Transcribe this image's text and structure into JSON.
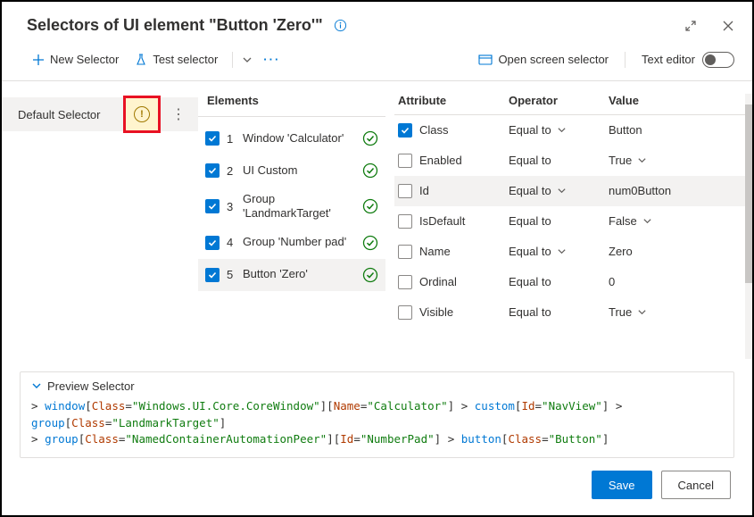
{
  "header": {
    "title": "Selectors of UI element \"Button 'Zero'\""
  },
  "toolbar": {
    "new_selector": "New Selector",
    "test_selector": "Test selector",
    "open_screen": "Open screen selector",
    "text_editor": "Text editor"
  },
  "left": {
    "selector_name": "Default Selector"
  },
  "elements": {
    "title": "Elements",
    "items": [
      {
        "idx": "1",
        "label": "Window 'Calculator'",
        "checked": true,
        "selected": false
      },
      {
        "idx": "2",
        "label": "UI Custom",
        "checked": true,
        "selected": false
      },
      {
        "idx": "3",
        "label": "Group 'LandmarkTarget'",
        "checked": true,
        "selected": false
      },
      {
        "idx": "4",
        "label": "Group 'Number pad'",
        "checked": true,
        "selected": false
      },
      {
        "idx": "5",
        "label": "Button 'Zero'",
        "checked": true,
        "selected": true
      }
    ]
  },
  "attributes": {
    "head_attr": "Attribute",
    "head_op": "Operator",
    "head_val": "Value",
    "rows": [
      {
        "attr": "Class",
        "checked": true,
        "op": "Equal to",
        "op_chev": true,
        "val": "Button",
        "val_chev": false,
        "hl": false
      },
      {
        "attr": "Enabled",
        "checked": false,
        "op": "Equal to",
        "op_chev": false,
        "val": "True",
        "val_chev": true,
        "hl": false
      },
      {
        "attr": "Id",
        "checked": false,
        "op": "Equal to",
        "op_chev": true,
        "val": "num0Button",
        "val_chev": false,
        "hl": true
      },
      {
        "attr": "IsDefault",
        "checked": false,
        "op": "Equal to",
        "op_chev": false,
        "val": "False",
        "val_chev": true,
        "hl": false
      },
      {
        "attr": "Name",
        "checked": false,
        "op": "Equal to",
        "op_chev": true,
        "val": "Zero",
        "val_chev": false,
        "hl": false
      },
      {
        "attr": "Ordinal",
        "checked": false,
        "op": "Equal to",
        "op_chev": false,
        "val": "0",
        "val_chev": false,
        "hl": false
      },
      {
        "attr": "Visible",
        "checked": false,
        "op": "Equal to",
        "op_chev": false,
        "val": "True",
        "val_chev": true,
        "hl": false
      }
    ]
  },
  "preview": {
    "title": "Preview Selector",
    "tokens": [
      [
        "gt",
        "> "
      ],
      [
        "tag",
        "window"
      ],
      [
        "br",
        "["
      ],
      [
        "attr",
        "Class"
      ],
      [
        "br",
        "="
      ],
      [
        "val",
        "\"Windows.UI.Core.CoreWindow\""
      ],
      [
        "br",
        "]"
      ],
      [
        "br",
        "["
      ],
      [
        "attr",
        "Name"
      ],
      [
        "br",
        "="
      ],
      [
        "val",
        "\"Calculator\""
      ],
      [
        "br",
        "]"
      ],
      [
        "gt",
        " > "
      ],
      [
        "tag",
        "custom"
      ],
      [
        "br",
        "["
      ],
      [
        "attr",
        "Id"
      ],
      [
        "br",
        "="
      ],
      [
        "val",
        "\"NavView\""
      ],
      [
        "br",
        "]"
      ],
      [
        "gt",
        " > "
      ],
      [
        "tag",
        "group"
      ],
      [
        "br",
        "["
      ],
      [
        "attr",
        "Class"
      ],
      [
        "br",
        "="
      ],
      [
        "val",
        "\"LandmarkTarget\""
      ],
      [
        "br",
        "]"
      ],
      [
        "nl",
        ""
      ],
      [
        "gt",
        "> "
      ],
      [
        "tag",
        "group"
      ],
      [
        "br",
        "["
      ],
      [
        "attr",
        "Class"
      ],
      [
        "br",
        "="
      ],
      [
        "val",
        "\"NamedContainerAutomationPeer\""
      ],
      [
        "br",
        "]"
      ],
      [
        "br",
        "["
      ],
      [
        "attr",
        "Id"
      ],
      [
        "br",
        "="
      ],
      [
        "val",
        "\"NumberPad\""
      ],
      [
        "br",
        "]"
      ],
      [
        "gt",
        " > "
      ],
      [
        "tag",
        "button"
      ],
      [
        "br",
        "["
      ],
      [
        "attr",
        "Class"
      ],
      [
        "br",
        "="
      ],
      [
        "val",
        "\"Button\""
      ],
      [
        "br",
        "]"
      ]
    ]
  },
  "footer": {
    "save": "Save",
    "cancel": "Cancel"
  }
}
